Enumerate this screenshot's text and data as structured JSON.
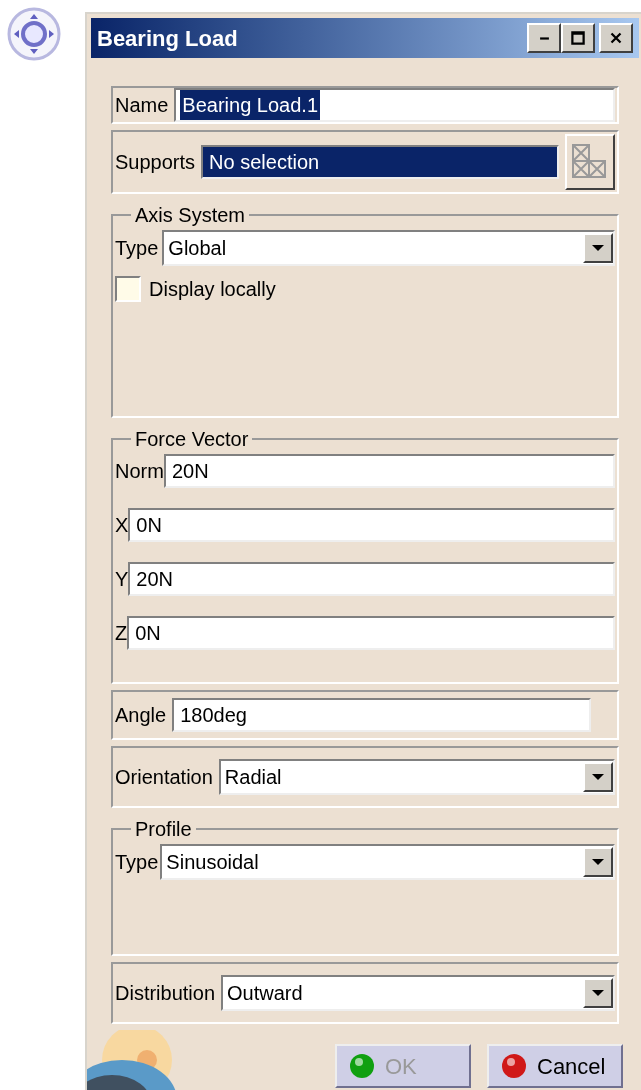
{
  "window": {
    "title": "Bearing Load"
  },
  "name": {
    "label": "Name",
    "value": "Bearing Load.1",
    "selected": true
  },
  "supports": {
    "label": "Supports",
    "value": "No selection",
    "selected": true
  },
  "axis_system": {
    "title": "Axis System",
    "type": {
      "label": "Type",
      "value": "Global"
    },
    "display_locally": {
      "label": "Display locally",
      "checked": false
    }
  },
  "force_vector": {
    "title": "Force Vector",
    "fields": [
      {
        "label": "Norm",
        "value": "20N"
      },
      {
        "label": "X",
        "value": "0N"
      },
      {
        "label": "Y",
        "value": "20N"
      },
      {
        "label": "Z",
        "value": "0N"
      }
    ]
  },
  "angle": {
    "label": "Angle",
    "value": "180deg"
  },
  "orientation": {
    "label": "Orientation",
    "value": "Radial"
  },
  "profile": {
    "title": "Profile",
    "type": {
      "label": "Type",
      "value": "Sinusoidal"
    }
  },
  "distribution": {
    "label": "Distribution",
    "value": "Outward"
  },
  "buttons": [
    {
      "kind": "ok",
      "label": "OK",
      "disabled": true
    },
    {
      "kind": "cancel",
      "label": "Cancel",
      "disabled": false
    }
  ]
}
